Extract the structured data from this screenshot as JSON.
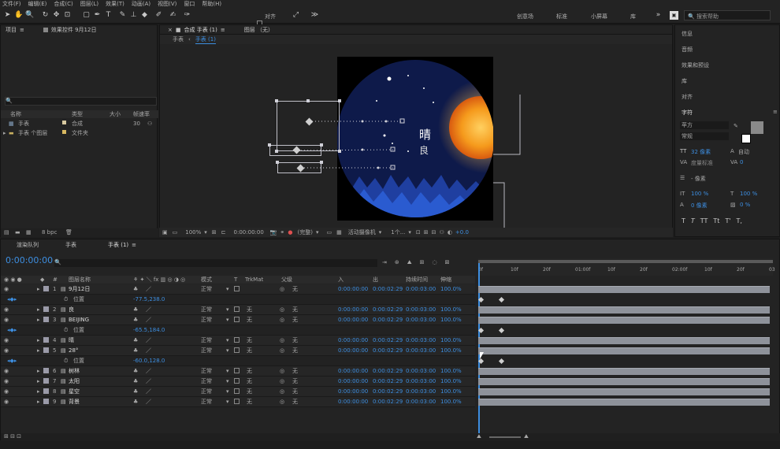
{
  "menu": [
    "文件(F)",
    "编辑(E)",
    "合成(C)",
    "图层(L)",
    "效果(T)",
    "动画(A)",
    "视图(V)",
    "窗口",
    "帮助(H)"
  ],
  "toolbar": {
    "align_label": "对齐",
    "workspaces": [
      "创意场",
      "标准",
      "小屏幕",
      "库"
    ],
    "search_placeholder": "搜索帮助"
  },
  "project": {
    "title": "项目",
    "effects_title": "效果控件 9月12日",
    "bit_depth": "8 bpc",
    "columns": {
      "name": "名称",
      "type": "类型",
      "size": "大小",
      "fps": "帧速率"
    },
    "items": [
      {
        "name": "手表",
        "type": "合成",
        "fps": "30"
      },
      {
        "name": "手表 个图层",
        "type": "文件夹",
        "fps": ""
      }
    ]
  },
  "viewer": {
    "comp_tab": "合成 手表 (1)",
    "layer_tab": "图层 （无）",
    "breadcrumb": [
      "手表",
      "手表 (1)"
    ],
    "comp_text": {
      "title": "晴",
      "subtitle": "良"
    },
    "footer": {
      "zoom": "100%",
      "timecode": "0:00:00:00",
      "quality": "(完整)",
      "camera": "活动摄像机",
      "views": "1个...",
      "exposure": "+0.0"
    }
  },
  "right_panel": {
    "items": [
      "信息",
      "音频",
      "效果和预设",
      "库",
      "对齐",
      "字符"
    ],
    "font_family": "苹方",
    "font_style": "常规",
    "font_size": "32 像素",
    "leading": "自动",
    "kerning": "度量标准",
    "tracking": "0",
    "stroke": "- 像素",
    "vscale": "100 %",
    "hscale": "100 %",
    "baseline": "0 像素",
    "tsume": "0 %",
    "styles": [
      "T",
      "T",
      "TT",
      "Tt",
      "T'",
      "T,"
    ]
  },
  "timeline": {
    "tabs": [
      "渲染队列",
      "手表",
      "手表 (1)"
    ],
    "timecode": "0:00:00:00",
    "headers": {
      "name": "图层名称",
      "mode": "模式",
      "trkmat": "TrkMat",
      "parent": "父级",
      "in": "入",
      "out": "出",
      "duration": "持续时间",
      "stretch": "伸缩"
    },
    "ruler": [
      "0f",
      "10f",
      "20f",
      "01:00f",
      "10f",
      "20f",
      "02:00f",
      "10f",
      "20f",
      "03"
    ],
    "rows": [
      {
        "num": "1",
        "name": "9月12日",
        "mode": "正常",
        "trk": "",
        "parent": "无",
        "in": "0:00:00:00",
        "out": "0:00:02:29",
        "dur": "0:00:03:00",
        "str": "100.0%",
        "sub": false
      },
      {
        "num": "",
        "name": "位置",
        "value": "-77.5,238.0",
        "sub": true
      },
      {
        "num": "2",
        "name": "良",
        "mode": "正常",
        "trk": "无",
        "parent": "无",
        "in": "0:00:00:00",
        "out": "0:00:02:29",
        "dur": "0:00:03:00",
        "str": "100.0%",
        "sub": false
      },
      {
        "num": "3",
        "name": "BEIJING",
        "mode": "正常",
        "trk": "无",
        "parent": "无",
        "in": "0:00:00:00",
        "out": "0:00:02:29",
        "dur": "0:00:03:00",
        "str": "100.0%",
        "sub": false
      },
      {
        "num": "",
        "name": "位置",
        "value": "-65.5,184.0",
        "sub": true
      },
      {
        "num": "4",
        "name": "晴",
        "mode": "正常",
        "trk": "无",
        "parent": "无",
        "in": "0:00:00:00",
        "out": "0:00:02:29",
        "dur": "0:00:03:00",
        "str": "100.0%",
        "sub": false
      },
      {
        "num": "5",
        "name": "28°",
        "mode": "正常",
        "trk": "无",
        "parent": "无",
        "in": "0:00:00:00",
        "out": "0:00:02:29",
        "dur": "0:00:03:00",
        "str": "100.0%",
        "sub": false
      },
      {
        "num": "",
        "name": "位置",
        "value": "-60.0,128.0",
        "sub": true
      },
      {
        "num": "6",
        "name": "树林",
        "mode": "正常",
        "trk": "无",
        "parent": "无",
        "in": "0:00:00:00",
        "out": "0:00:02:29",
        "dur": "0:00:03:00",
        "str": "100.0%",
        "sub": false
      },
      {
        "num": "7",
        "name": "太阳",
        "mode": "正常",
        "trk": "无",
        "parent": "无",
        "in": "0:00:00:00",
        "out": "0:00:02:29",
        "dur": "0:00:03:00",
        "str": "100.0%",
        "sub": false
      },
      {
        "num": "8",
        "name": "星空",
        "mode": "正常",
        "trk": "无",
        "parent": "无",
        "in": "0:00:00:00",
        "out": "0:00:02:29",
        "dur": "0:00:03:00",
        "str": "100.0%",
        "sub": false
      },
      {
        "num": "9",
        "name": "背景",
        "mode": "正常",
        "trk": "无",
        "parent": "无",
        "in": "0:00:00:00",
        "out": "0:00:02:29",
        "dur": "0:00:03:00",
        "str": "100.0%",
        "sub": false
      }
    ]
  },
  "colors": {
    "accent": "#3d8ee0",
    "panel": "#232323",
    "sky": "#0e1a4a",
    "sun": "#f5a623"
  }
}
